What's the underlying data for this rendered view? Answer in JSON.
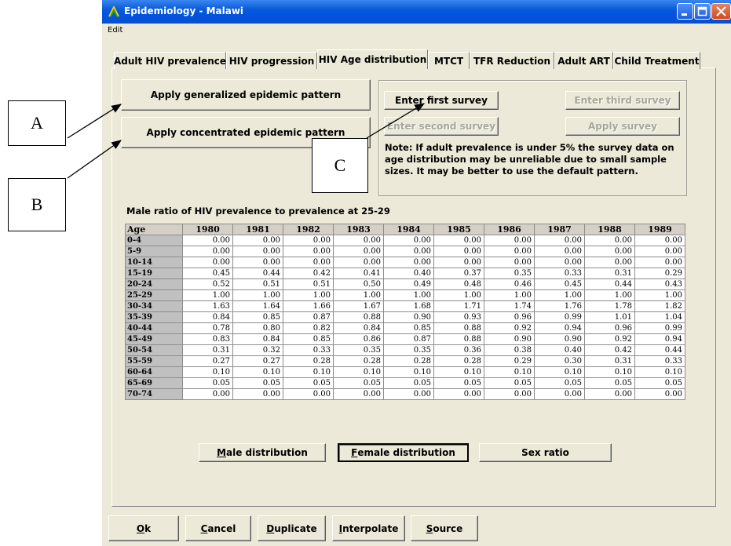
{
  "window": {
    "title": "Epidemiology - Malawi",
    "menu": [
      "Edit"
    ]
  },
  "tabs": [
    "Adult HIV prevalence",
    "HIV progression",
    "HIV Age distribution",
    "MTCT",
    "TFR Reduction",
    "Adult ART",
    "Child Treatment"
  ],
  "active_tab": "HIV Age distribution",
  "buttons": {
    "generalized": "Apply generalized epidemic pattern",
    "concentrated": "Apply concentrated epidemic pattern",
    "first_survey": "Enter first survey",
    "second_survey": "Enter second survey",
    "third_survey": "Enter third survey",
    "apply_survey": "Apply survey"
  },
  "note": "Note: If adult prevalence is under 5% the survey data on age distribution may be unreliable due to small sample sizes. It may be better to use the default pattern.",
  "table": {
    "title": "Male ratio of HIV prevalence to prevalence at 25-29",
    "headers": [
      "Age",
      "1980",
      "1981",
      "1982",
      "1983",
      "1984",
      "1985",
      "1986",
      "1987",
      "1988",
      "1989"
    ],
    "rows": [
      {
        "age": "0-4",
        "values": [
          "0.00",
          "0.00",
          "0.00",
          "0.00",
          "0.00",
          "0.00",
          "0.00",
          "0.00",
          "0.00",
          "0.00"
        ]
      },
      {
        "age": " 5-9",
        "values": [
          "0.00",
          "0.00",
          "0.00",
          "0.00",
          "0.00",
          "0.00",
          "0.00",
          "0.00",
          "0.00",
          "0.00"
        ]
      },
      {
        "age": "10-14",
        "values": [
          "0.00",
          "0.00",
          "0.00",
          "0.00",
          "0.00",
          "0.00",
          "0.00",
          "0.00",
          "0.00",
          "0.00"
        ]
      },
      {
        "age": "15-19",
        "values": [
          "0.45",
          "0.44",
          "0.42",
          "0.41",
          "0.40",
          "0.37",
          "0.35",
          "0.33",
          "0.31",
          "0.29"
        ]
      },
      {
        "age": "20-24",
        "values": [
          "0.52",
          "0.51",
          "0.51",
          "0.50",
          "0.49",
          "0.48",
          "0.46",
          "0.45",
          "0.44",
          "0.43"
        ]
      },
      {
        "age": "25-29",
        "values": [
          "1.00",
          "1.00",
          "1.00",
          "1.00",
          "1.00",
          "1.00",
          "1.00",
          "1.00",
          "1.00",
          "1.00"
        ]
      },
      {
        "age": "30-34",
        "values": [
          "1.63",
          "1.64",
          "1.66",
          "1.67",
          "1.68",
          "1.71",
          "1.74",
          "1.76",
          "1.78",
          "1.82"
        ]
      },
      {
        "age": "35-39",
        "values": [
          "0.84",
          "0.85",
          "0.87",
          "0.88",
          "0.90",
          "0.93",
          "0.96",
          "0.99",
          "1.01",
          "1.04"
        ]
      },
      {
        "age": "40-44",
        "values": [
          "0.78",
          "0.80",
          "0.82",
          "0.84",
          "0.85",
          "0.88",
          "0.92",
          "0.94",
          "0.96",
          "0.99"
        ]
      },
      {
        "age": "45-49",
        "values": [
          "0.83",
          "0.84",
          "0.85",
          "0.86",
          "0.87",
          "0.88",
          "0.90",
          "0.90",
          "0.92",
          "0.94"
        ]
      },
      {
        "age": "50-54",
        "values": [
          "0.31",
          "0.32",
          "0.33",
          "0.35",
          "0.35",
          "0.36",
          "0.38",
          "0.40",
          "0.42",
          "0.44"
        ]
      },
      {
        "age": "55-59",
        "values": [
          "0.27",
          "0.27",
          "0.28",
          "0.28",
          "0.28",
          "0.28",
          "0.29",
          "0.30",
          "0.31",
          "0.33"
        ]
      },
      {
        "age": "60-64",
        "values": [
          "0.10",
          "0.10",
          "0.10",
          "0.10",
          "0.10",
          "0.10",
          "0.10",
          "0.10",
          "0.10",
          "0.10"
        ]
      },
      {
        "age": "65-69",
        "values": [
          "0.05",
          "0.05",
          "0.05",
          "0.05",
          "0.05",
          "0.05",
          "0.05",
          "0.05",
          "0.05",
          "0.05"
        ]
      },
      {
        "age": "70-74",
        "values": [
          "0.00",
          "0.00",
          "0.00",
          "0.00",
          "0.00",
          "0.00",
          "0.00",
          "0.00",
          "0.00",
          "0.00"
        ]
      }
    ]
  },
  "distribution_buttons": [
    {
      "first": "M",
      "rest": "ale distribution"
    },
    {
      "first": "F",
      "rest": "emale distribution"
    },
    {
      "first": "",
      "rest": "Sex ratio"
    }
  ],
  "footer_buttons": [
    {
      "first": "O",
      "rest": "k"
    },
    {
      "first": "C",
      "rest": "ancel"
    },
    {
      "first": "D",
      "rest": "uplicate"
    },
    {
      "first": "I",
      "rest": "nterpolate"
    },
    {
      "first": "S",
      "rest": "ource"
    }
  ],
  "callouts": [
    "A",
    "B",
    "C"
  ]
}
